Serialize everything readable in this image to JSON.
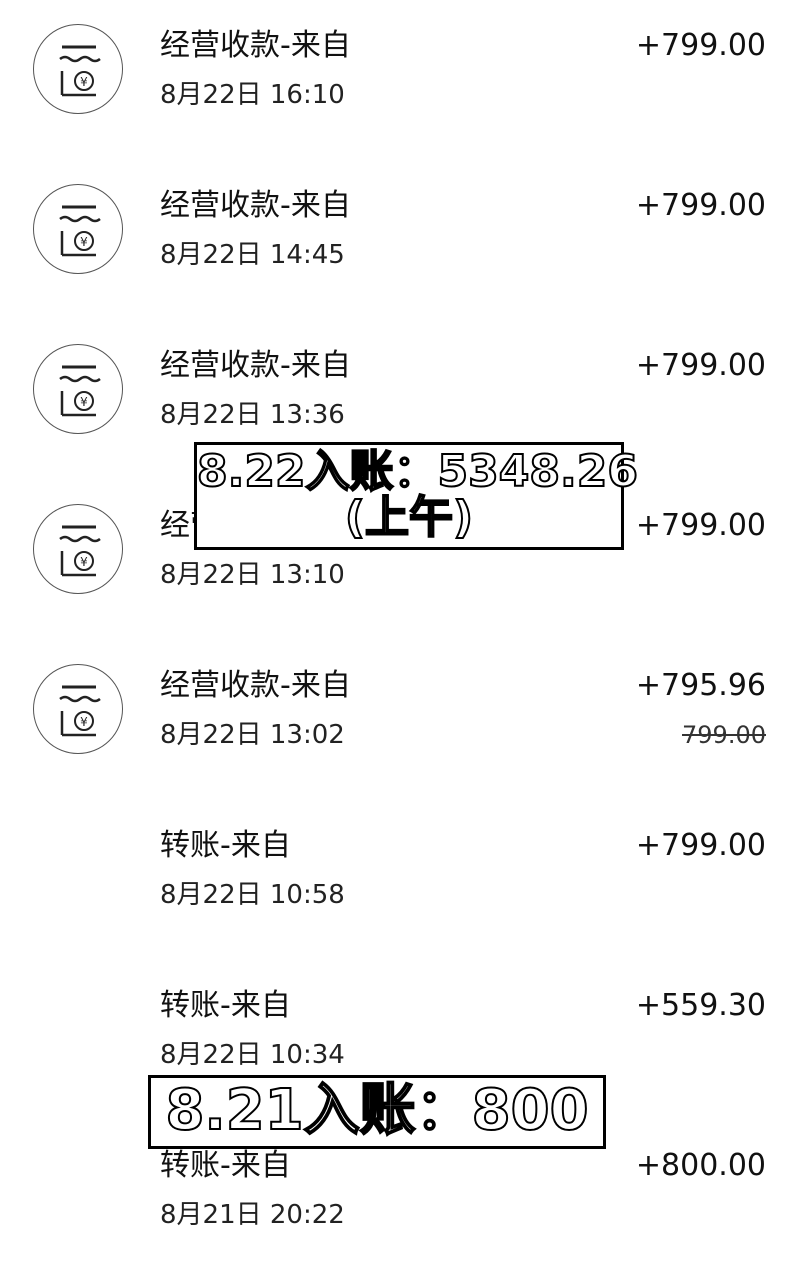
{
  "transactions": [
    {
      "title": "经营收款-来自",
      "time": "8月22日 16:10",
      "amount": "+799.00",
      "has_icon": true
    },
    {
      "title": "经营收款-来自",
      "time": "8月22日 14:45",
      "amount": "+799.00",
      "has_icon": true
    },
    {
      "title": "经营收款-来自",
      "time": "8月22日 13:36",
      "amount": "+799.00",
      "has_icon": true
    },
    {
      "title": "经营收款-来自",
      "time": "8月22日 13:10",
      "amount": "+799.00",
      "has_icon": true
    },
    {
      "title": "经营收款-来自",
      "time": "8月22日 13:02",
      "amount": "+795.96",
      "original_amount": "799.00",
      "has_icon": true
    },
    {
      "title": "转账-来自",
      "time": "8月22日 10:58",
      "amount": "+799.00",
      "has_icon": false
    },
    {
      "title": "转账-来自",
      "time": "8月22日 10:34",
      "amount": "+559.30",
      "has_icon": false
    },
    {
      "title": "转账-来自",
      "time": "8月21日 20:22",
      "amount": "+800.00",
      "has_icon": false
    }
  ],
  "overlays": {
    "overlay_822_line1": "8.22入账：5348.26",
    "overlay_822_line2": "(上午)",
    "overlay_821": "8.21入账：800"
  },
  "icon": {
    "name": "merchant-payment-icon",
    "stroke_color": "#222222"
  }
}
